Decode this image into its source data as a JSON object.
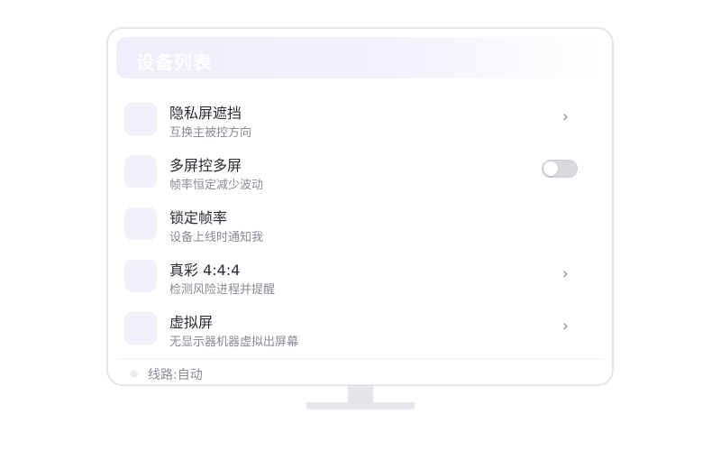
{
  "header": {
    "title": "设备列表"
  },
  "items": [
    {
      "title": "隐私屏遮挡",
      "subtitle": "互换主被控方向",
      "control": "chevron",
      "chevron": "›"
    },
    {
      "title": "多屏控多屏",
      "subtitle": "帧率恒定减少波动",
      "control": "toggle",
      "toggle_on": false
    },
    {
      "title": "锁定帧率",
      "subtitle": "设备上线时通知我",
      "control": "none"
    },
    {
      "title": "真彩 4:4:4",
      "subtitle": "检测风险进程并提醒",
      "control": "chevron",
      "chevron": "›"
    },
    {
      "title": "虚拟屏",
      "subtitle": "无显示器机器虚拟出屏幕",
      "control": "chevron",
      "chevron": "›"
    }
  ],
  "footer": {
    "route_label": "线路:自动"
  },
  "colors": {
    "accent_light": "#efedfb",
    "icon_bg": "#f2f0fb",
    "toggle_off": "#d9dadf"
  }
}
